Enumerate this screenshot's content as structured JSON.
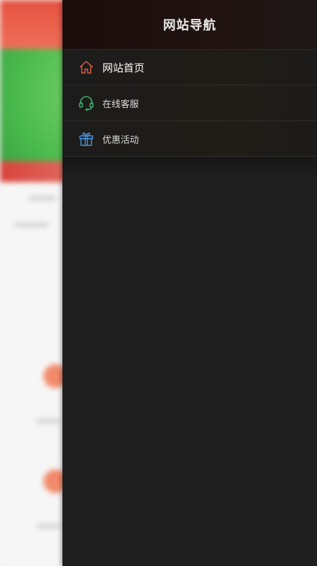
{
  "drawer": {
    "title": "网站导航",
    "items": [
      {
        "label": "网站首页",
        "icon": "home-icon",
        "color": "#e0594a"
      },
      {
        "label": "在线客服",
        "icon": "headset-icon",
        "color": "#3bb36a"
      },
      {
        "label": "优惠活动",
        "icon": "gift-icon",
        "color": "#4a8fd6"
      }
    ]
  }
}
